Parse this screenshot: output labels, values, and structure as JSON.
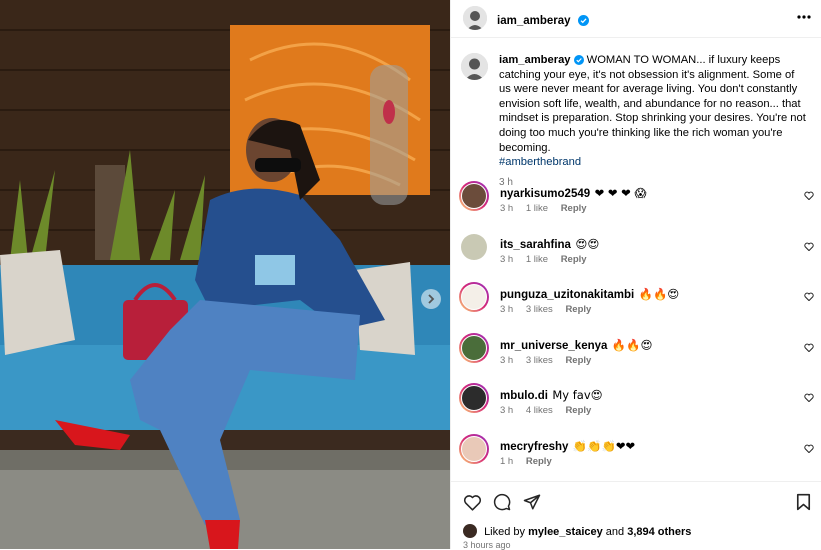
{
  "post": {
    "author": "iam_amberay",
    "caption_text": "WOMAN TO WOMAN... if luxury keeps catching your eye, it's not obsession it's alignment. Some of us were never meant for average living. You don't constantly envision soft life, wealth, and abundance for no reason... that mindset is preparation. Stop shrinking your desires. You're not doing too much you're thinking like the rich woman you're becoming.",
    "hashtag": "#amberthebrand",
    "caption_time": "3 h"
  },
  "comments": [
    {
      "user": "nyarkisumo2549",
      "text": "❤ ❤ ❤ 😱",
      "time": "3 h",
      "likes": "1 like",
      "reply": "Reply"
    },
    {
      "user": "its_sarahfina",
      "text": "😍😍",
      "time": "3 h",
      "likes": "1 like",
      "reply": "Reply"
    },
    {
      "user": "punguza_uzitonakitambi",
      "text": "🔥🔥😍",
      "time": "3 h",
      "likes": "3 likes",
      "reply": "Reply"
    },
    {
      "user": "mr_universe_kenya",
      "text": "🔥🔥😍",
      "time": "3 h",
      "likes": "3 likes",
      "reply": "Reply"
    },
    {
      "user": "mbulo.di",
      "text": "My fav😍",
      "time": "3 h",
      "likes": "4 likes",
      "reply": "Reply"
    },
    {
      "user": "mecryfreshy",
      "text": "👏👏👏❤❤",
      "time": "1 h",
      "likes": "",
      "reply": "Reply"
    }
  ],
  "footer": {
    "liked_by_prefix": "Liked by",
    "liked_by_user": "mylee_staicey",
    "liked_by_and": "and",
    "liked_by_others": "3,894 others",
    "time_ago": "3 hours ago"
  },
  "colors": {
    "verified": "#0095f6",
    "hashtag": "#00376b",
    "meta": "#737373",
    "story_ring": "#d6249f"
  },
  "icons": [
    "verified-badge-icon",
    "more-options-icon",
    "heart-icon",
    "comment-icon",
    "share-icon",
    "bookmark-icon",
    "carousel-next-icon"
  ]
}
